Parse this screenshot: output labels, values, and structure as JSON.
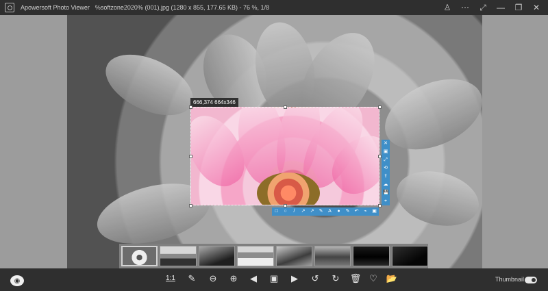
{
  "app": {
    "name": "Apowersoft Photo Viewer",
    "file_info": "%softzone2020% (001).jpg (1280 x 855, 177.65 KB) - 76 %, 1/8"
  },
  "titlebar": {
    "controls": [
      {
        "name": "user-icon",
        "glyph": "♙"
      },
      {
        "name": "more-icon",
        "glyph": "⋯"
      },
      {
        "name": "fullscreen-icon",
        "glyph": "⤢"
      },
      {
        "name": "minimize-icon",
        "glyph": "—"
      },
      {
        "name": "restore-icon",
        "glyph": "❐"
      },
      {
        "name": "close-icon",
        "glyph": "✕"
      }
    ]
  },
  "selection": {
    "size_label": "666,374 664x346"
  },
  "vertical_tools": [
    {
      "name": "close-icon",
      "glyph": "✕"
    },
    {
      "name": "copy-icon",
      "glyph": "▣"
    },
    {
      "name": "expand-icon",
      "glyph": "⤢"
    },
    {
      "name": "share-icon",
      "glyph": "⟲"
    },
    {
      "name": "upload-icon",
      "glyph": "⇪"
    },
    {
      "name": "cloud-icon",
      "glyph": "☁"
    },
    {
      "name": "save-icon",
      "glyph": "💾"
    },
    {
      "name": "pin-icon",
      "glyph": "⌖"
    }
  ],
  "horizontal_tools": [
    {
      "name": "rectangle-icon",
      "glyph": "□"
    },
    {
      "name": "ellipse-icon",
      "glyph": "○"
    },
    {
      "name": "line-icon",
      "glyph": "/"
    },
    {
      "name": "arrow-icon",
      "glyph": "↗"
    },
    {
      "name": "curve-arrow-icon",
      "glyph": "↗"
    },
    {
      "name": "pen-icon",
      "glyph": "✎"
    },
    {
      "name": "text-icon",
      "glyph": "A"
    },
    {
      "name": "drop-icon",
      "glyph": "●"
    },
    {
      "name": "marker-icon",
      "glyph": "✎"
    },
    {
      "name": "undo-icon",
      "glyph": "↶"
    },
    {
      "name": "wand-icon",
      "glyph": "⌁"
    },
    {
      "name": "image-icon",
      "glyph": "▣"
    }
  ],
  "thumbnails": [
    {
      "name": "thumbnail-1-flower",
      "active": true
    },
    {
      "name": "thumbnail-2-beach",
      "active": false
    },
    {
      "name": "thumbnail-3-mountain",
      "active": false
    },
    {
      "name": "thumbnail-4-forest",
      "active": false
    },
    {
      "name": "thumbnail-5-landscape",
      "active": false
    },
    {
      "name": "thumbnail-6-bridge",
      "active": false
    },
    {
      "name": "thumbnail-7-dark",
      "active": false
    },
    {
      "name": "thumbnail-8-night",
      "active": false
    }
  ],
  "bottom_toolbar": {
    "camera_icon": "camera-icon",
    "zoom_label": "1:1",
    "tools": [
      {
        "name": "edit-icon",
        "glyph": "✎"
      },
      {
        "name": "zoom-out-icon",
        "glyph": "⊖"
      },
      {
        "name": "zoom-in-icon",
        "glyph": "⊕"
      },
      {
        "name": "previous-icon",
        "glyph": "◀"
      },
      {
        "name": "slideshow-icon",
        "glyph": "▣"
      },
      {
        "name": "next-icon",
        "glyph": "▶"
      },
      {
        "name": "rotate-left-icon",
        "glyph": "↺"
      },
      {
        "name": "rotate-right-icon",
        "glyph": "↻"
      },
      {
        "name": "delete-icon",
        "glyph": "🗑"
      },
      {
        "name": "favorite-icon",
        "glyph": "♡"
      },
      {
        "name": "open-folder-icon",
        "glyph": "📂"
      }
    ],
    "thumbnail_label": "Thumbnail",
    "thumbnail_toggle": true
  }
}
